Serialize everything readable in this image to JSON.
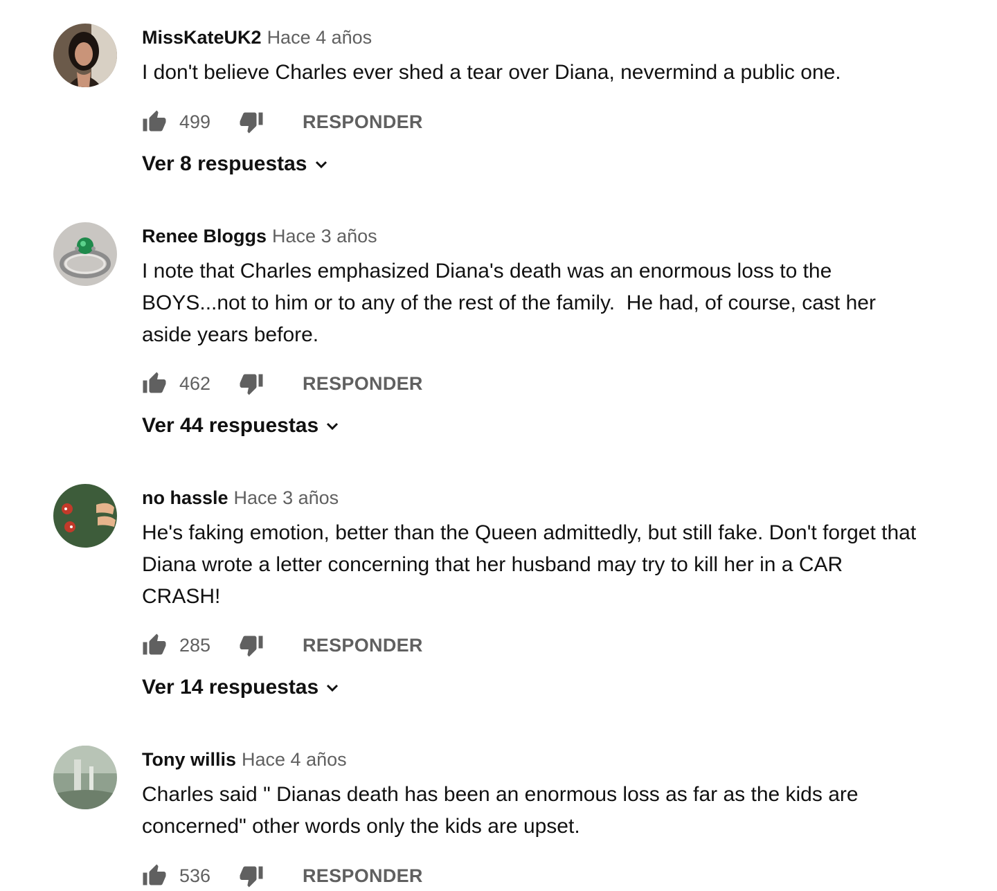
{
  "reply_label": "RESPONDER",
  "comments": [
    {
      "author": "MissKateUK2",
      "time": "Hace 4 años",
      "text": "I don't believe Charles ever shed a tear over Diana, nevermind a public one.",
      "likes": "499",
      "replies": "Ver 8 respuestas"
    },
    {
      "author": "Renee Bloggs",
      "time": "Hace 3 años",
      "text": "I note that Charles emphasized Diana's death was an enormous loss to the BOYS...not to him or to any of the rest of the family.  He had, of course, cast her aside years before.",
      "likes": "462",
      "replies": "Ver 44 respuestas"
    },
    {
      "author": "no hassle",
      "time": "Hace 3 años",
      "text": "He's faking emotion, better than the Queen admittedly, but still fake. Don't forget that Diana wrote a letter concerning that her husband may try to kill her in a CAR CRASH!",
      "likes": "285",
      "replies": "Ver 14 respuestas"
    },
    {
      "author": "Tony willis",
      "time": "Hace 4 años",
      "text": "Charles said \" Dianas death has been an enormous loss as far as the kids are concerned\" other words only the kids are upset.",
      "likes": "536"
    }
  ],
  "icons": {
    "like": "thumbs-up-icon",
    "dislike": "thumbs-down-icon",
    "expand": "chevron-down-icon"
  },
  "colors": {
    "text": "#111111",
    "secondary": "#606060",
    "background": "#ffffff"
  }
}
